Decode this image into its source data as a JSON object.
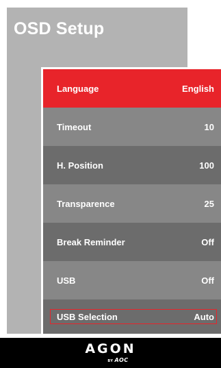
{
  "setup": {
    "title": "OSD Setup"
  },
  "menu": {
    "items": [
      {
        "label": "Language",
        "value": "English",
        "state": "active"
      },
      {
        "label": "Timeout",
        "value": "10"
      },
      {
        "label": "H. Position",
        "value": "100"
      },
      {
        "label": "Transparence",
        "value": "25"
      },
      {
        "label": "Break Reminder",
        "value": "Off"
      },
      {
        "label": "USB",
        "value": "Off"
      },
      {
        "label": "USB Selection",
        "value": "Auto",
        "state": "focused"
      }
    ]
  },
  "footer": {
    "brand": "AGON",
    "sub_by": "BY",
    "sub_aoc": "AOC"
  },
  "colors": {
    "active_row": "#e8242a",
    "row_light": "#878787",
    "row_dark": "#6c6c6c",
    "panel": "#b3b3b3",
    "footer_bg": "#000000"
  }
}
